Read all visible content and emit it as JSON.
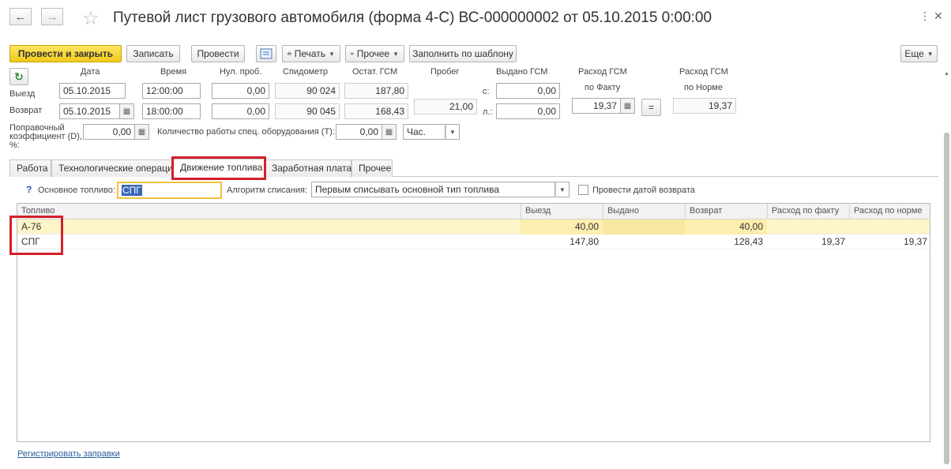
{
  "window": {
    "title": "Путевой лист грузового автомобиля (форма 4-С) ВС-000000002 от 05.10.2015 0:00:00",
    "controls": [
      "⋮",
      "✕"
    ]
  },
  "nav": {
    "back": "←",
    "forward": "→",
    "star": "☆"
  },
  "toolbar": {
    "post_close": "Провести и закрыть",
    "save": "Записать",
    "post": "Провести",
    "print": "Печать",
    "other": "Прочее",
    "fill_template": "Заполнить по шаблону",
    "more": "Еще"
  },
  "headers": {
    "date": "Дата",
    "time": "Время",
    "zero_mileage": "Нул. проб.",
    "speedometer": "Спидометр",
    "fuel_left": "Остат. ГСМ",
    "mileage": "Пробег",
    "issued": "Выдано ГСМ",
    "fact_1": "Расход ГСМ",
    "fact_2": "по Факту",
    "norm_1": "Расход ГСМ",
    "norm_2": "по Норме"
  },
  "rows": {
    "depart": {
      "label": "Выезд",
      "date": "05.10.2015",
      "time": "12:00:00",
      "zero": "0,00",
      "speedo": "90 024",
      "fuel": "187,80"
    },
    "return": {
      "label": "Возврат",
      "date": "05.10.2015",
      "time": "18:00:00",
      "zero": "0,00",
      "speedo": "90 045",
      "fuel": "168,43"
    }
  },
  "mileage_value": "21,00",
  "issued": {
    "from_label": "с:",
    "from_value": "0,00",
    "to_label": "л.:",
    "to_value": "0,00"
  },
  "fact_value": "19,37",
  "equals_button": "=",
  "norm_value": "19,37",
  "correction": {
    "label_lines": [
      "Поправочный",
      "коэффициент (D),",
      "%:"
    ],
    "value": "0,00"
  },
  "special_work": {
    "label": "Количество работы спец. оборудования (T):",
    "value": "0,00",
    "unit": "Час."
  },
  "tabs": [
    "Работа",
    "Технологические операции",
    "Движение топлива",
    "Заработная плата",
    "Прочее"
  ],
  "active_tab": 2,
  "fuel_settings": {
    "help": "?",
    "main_fuel_label": "Основное топливо:",
    "main_fuel_value": "СПГ",
    "algorithm_label": "Алгоритм списания:",
    "algorithm_value": "Первым списывать основной тип топлива",
    "post_by_return_label": "Провести датой возврата"
  },
  "table": {
    "columns": [
      "Топливо",
      "Выезд",
      "Выдано",
      "Возврат",
      "Расход по факту",
      "Расход по норме"
    ],
    "rows": [
      {
        "fuel": "А-76",
        "depart": "40,00",
        "issued": "",
        "return": "40,00",
        "fact": "",
        "norm": ""
      },
      {
        "fuel": "СПГ",
        "depart": "147,80",
        "issued": "",
        "return": "128,43",
        "fact": "19,37",
        "norm": "19,37"
      }
    ]
  },
  "register_link": "Регистрировать заправки",
  "colors": {
    "highlight": "#d4202b",
    "primary_button": "#f5cf24",
    "selected_row": "#fdf5c8",
    "link": "#2b5d9c"
  }
}
